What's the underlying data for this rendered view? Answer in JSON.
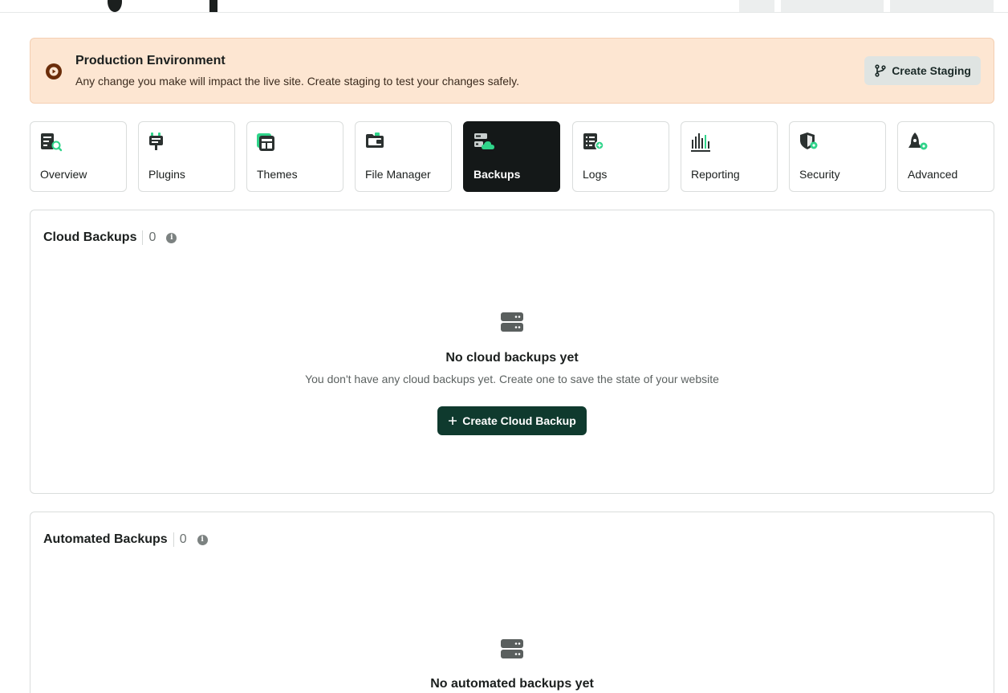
{
  "alert": {
    "title": "Production Environment",
    "description": "Any change you make will impact the live site. Create staging to test your changes safely.",
    "button_label": "Create Staging",
    "icon": "play-circle-icon",
    "background_color": "#fde6d2"
  },
  "tabs": [
    {
      "label": "Overview",
      "icon": "overview-icon",
      "active": false
    },
    {
      "label": "Plugins",
      "icon": "plugin-icon",
      "active": false
    },
    {
      "label": "Themes",
      "icon": "themes-icon",
      "active": false
    },
    {
      "label": "File Manager",
      "icon": "folder-icon",
      "active": false
    },
    {
      "label": "Backups",
      "icon": "backup-cloud-icon",
      "active": true
    },
    {
      "label": "Logs",
      "icon": "logs-icon",
      "active": false
    },
    {
      "label": "Reporting",
      "icon": "bar-chart-icon",
      "active": false
    },
    {
      "label": "Security",
      "icon": "shield-icon",
      "active": false
    },
    {
      "label": "Advanced",
      "icon": "rocket-gear-icon",
      "active": false
    }
  ],
  "cloud_backups": {
    "title": "Cloud Backups",
    "count": "0",
    "empty_title": "No cloud backups yet",
    "empty_description": "You don't have any cloud backups yet. Create one to save the state of your website",
    "button_label": "Create Cloud Backup"
  },
  "automated_backups": {
    "title": "Automated Backups",
    "count": "0",
    "empty_title": "No automated backups yet"
  },
  "colors": {
    "accent_green": "#2fd48a",
    "dark": "#141818",
    "primary_button": "#0f3a2e"
  }
}
